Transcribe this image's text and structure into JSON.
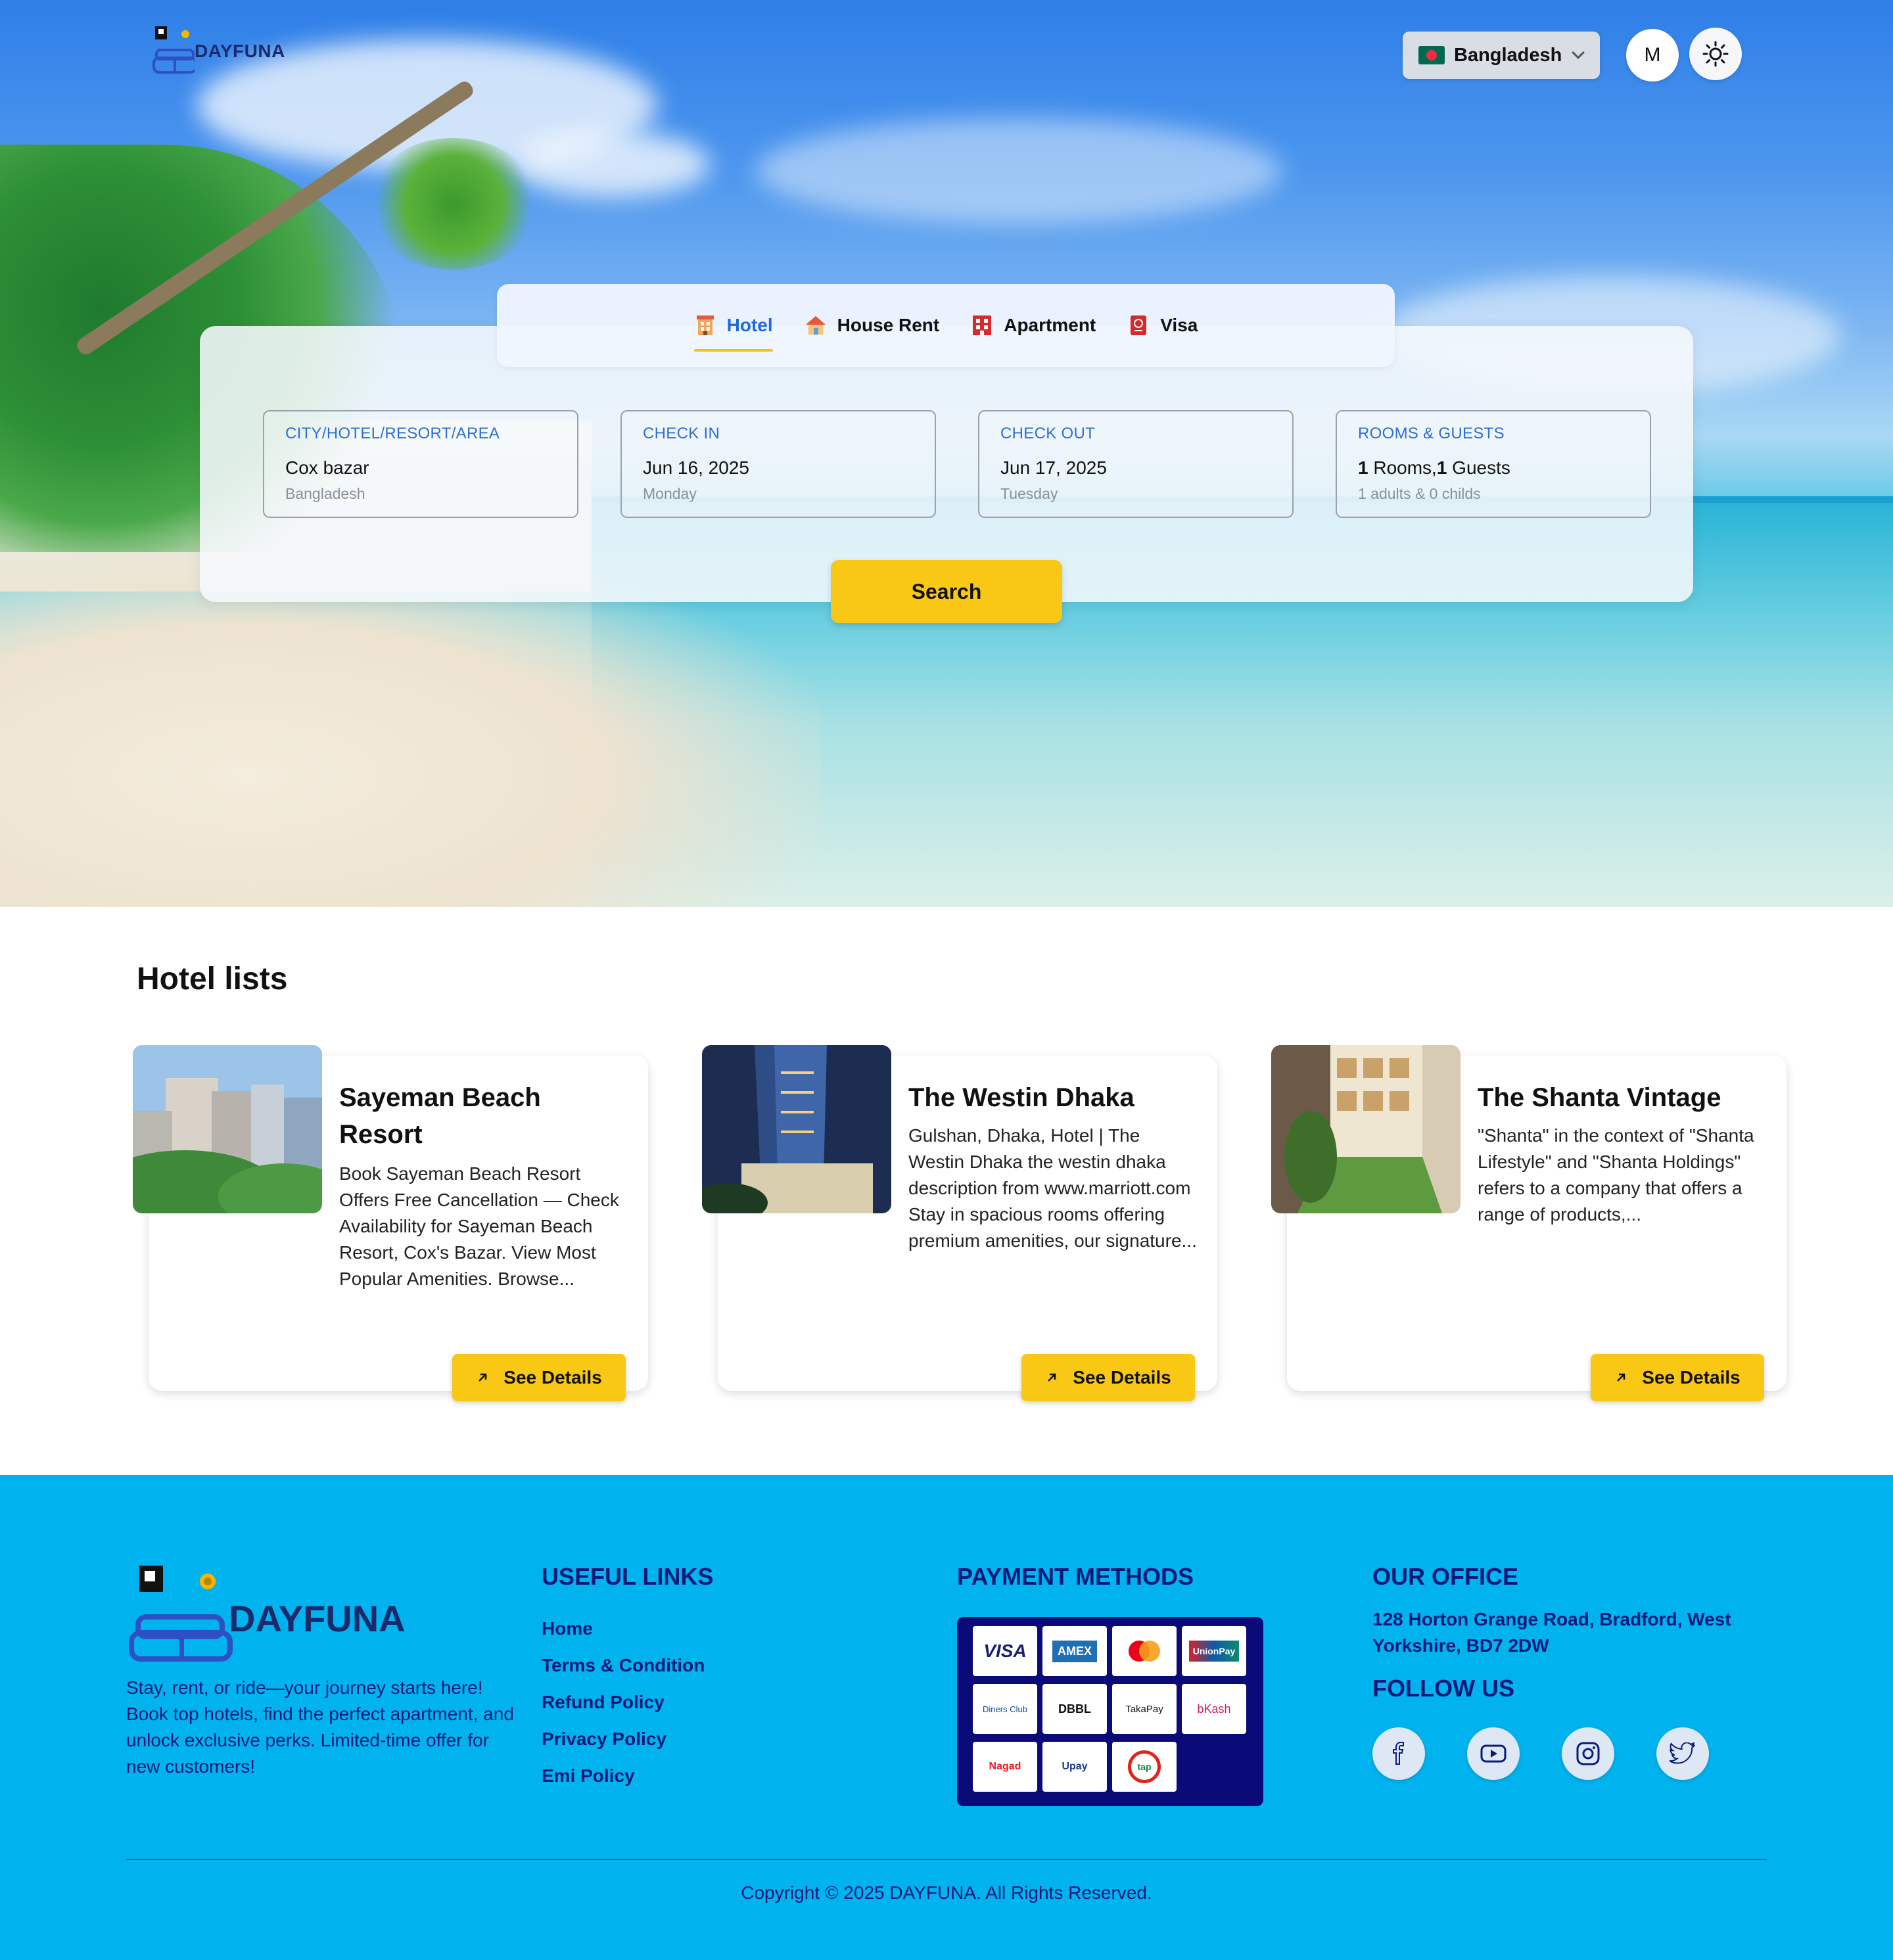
{
  "brand": {
    "name": "DAYFUNA"
  },
  "header": {
    "country": "Bangladesh",
    "avatar_initial": "M"
  },
  "tabs": [
    {
      "label": "Hotel",
      "icon": "hotel-icon",
      "active": true
    },
    {
      "label": "House Rent",
      "icon": "house-icon",
      "active": false
    },
    {
      "label": "Apartment",
      "icon": "apartment-icon",
      "active": false
    },
    {
      "label": "Visa",
      "icon": "passport-icon",
      "active": false
    }
  ],
  "search": {
    "location": {
      "label": "CITY/HOTEL/RESORT/AREA",
      "value": "Cox bazar",
      "sub": "Bangladesh"
    },
    "checkin": {
      "label": "CHECK IN",
      "value": "Jun 16, 2025",
      "sub": "Monday"
    },
    "checkout": {
      "label": "CHECK OUT",
      "value": "Jun 17, 2025",
      "sub": "Tuesday"
    },
    "rooms": {
      "label": "ROOMS & GUESTS",
      "rooms_count": "1",
      "rooms_text": " Rooms,",
      "guests_count": "1",
      "guests_text": " Guests",
      "sub": "1 adults & 0 childs"
    },
    "button_label": "Search"
  },
  "hotels": {
    "title": "Hotel lists",
    "details_label": "See Details",
    "items": [
      {
        "name": "Sayeman Beach Resort",
        "description": "Book Sayeman Beach Resort Offers Free Cancellation — Check Availability for Sayeman Beach Resort, Cox's Bazar. View Most Popular Amenities. Browse..."
      },
      {
        "name": "The Westin Dhaka",
        "description": "Gulshan, Dhaka, Hotel | The Westin Dhaka the westin dhaka description from www.marriott.com Stay in spacious rooms offering premium amenities, our signature..."
      },
      {
        "name": "The Shanta Vintage",
        "description": "\"Shanta\" in the context of \"Shanta Lifestyle\" and \"Shanta Holdings\" refers to a company that offers a range of products,..."
      }
    ]
  },
  "footer": {
    "tagline": "Stay, rent, or ride—your journey starts here! Book top hotels, find the perfect apartment, and unlock exclusive perks. Limited-time offer for new customers!",
    "useful_links_title": "USEFUL LINKS",
    "links": [
      "Home",
      "Terms & Condition",
      "Refund Policy",
      "Privacy Policy",
      "Emi Policy"
    ],
    "payment_title": "PAYMENT METHODS",
    "payments": [
      "VISA",
      "AMEX",
      "Mastercard",
      "UnionPay",
      "Diners Club",
      "DBBL",
      "TakaPay",
      "bKash",
      "Nagad",
      "Upay",
      "tap"
    ],
    "office_title": "OUR OFFICE",
    "address": "128 Horton Grange Road, Bradford, West Yorkshire, BD7 2DW",
    "follow_title": "FOLLOW US",
    "social": [
      "facebook-icon",
      "youtube-icon",
      "instagram-icon",
      "twitter-icon"
    ],
    "copyright": "Copyright © 2025 DAYFUNA. All Rights Reserved."
  },
  "colors": {
    "accent": "#f9c814",
    "link_blue": "#1f6ad8",
    "footer_bg": "#00b2ee",
    "footer_text": "#0b1a7a"
  }
}
